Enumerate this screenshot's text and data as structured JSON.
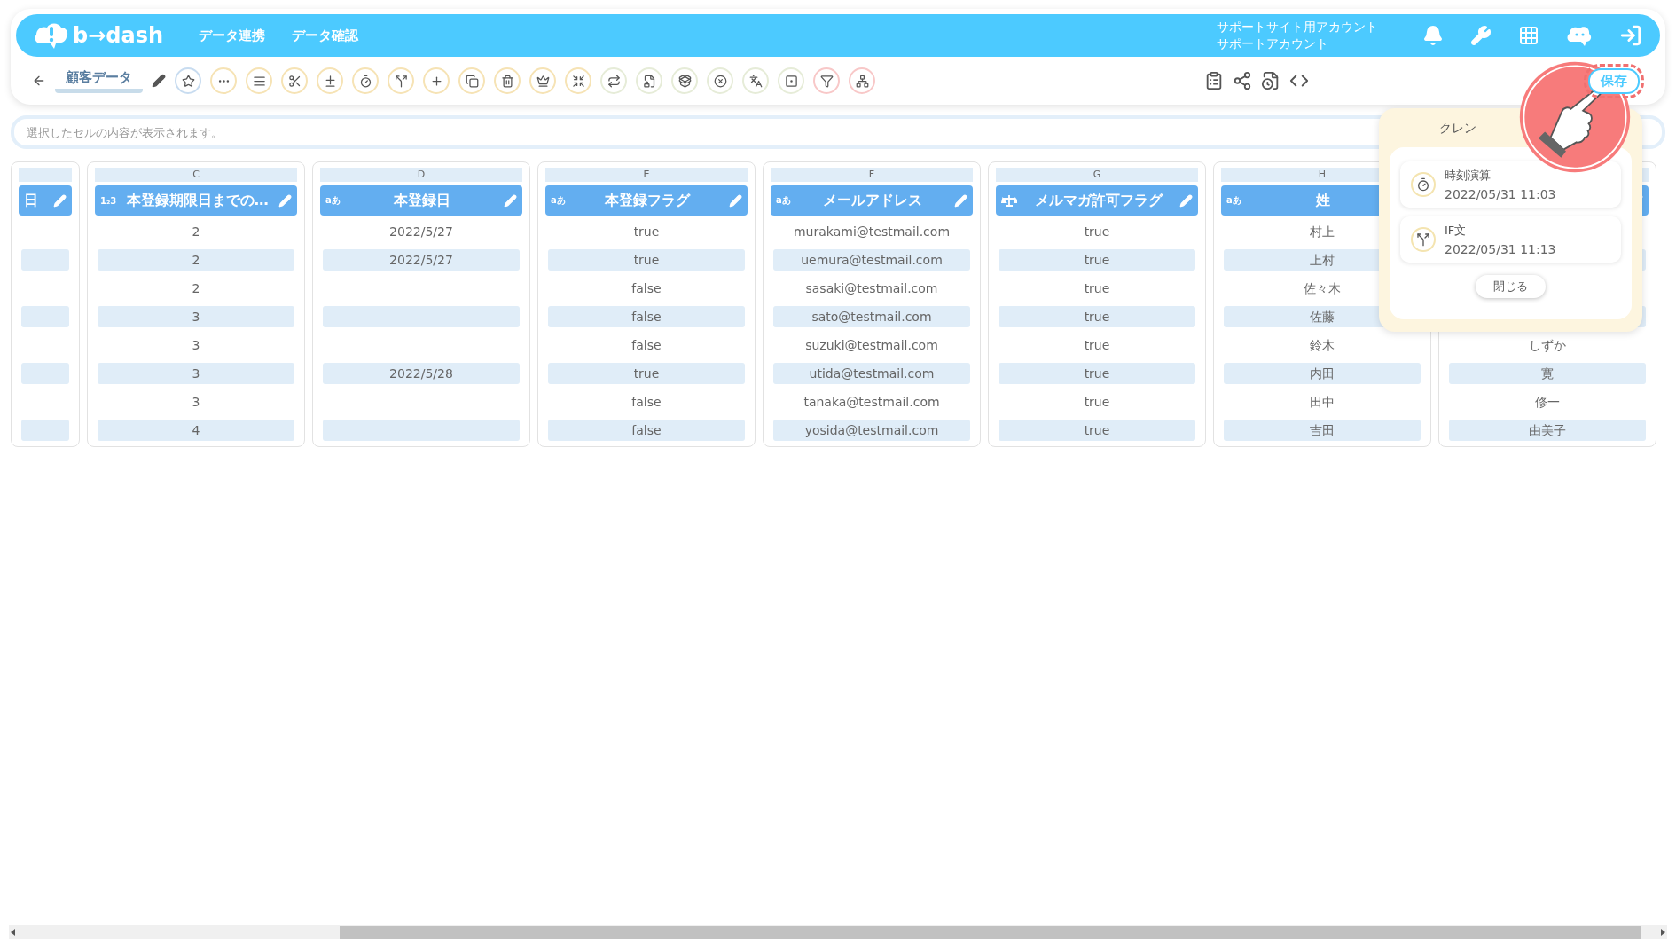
{
  "header": {
    "logo": "b→dash",
    "nav": [
      {
        "label": "データ連携"
      },
      {
        "label": "データ確認"
      }
    ],
    "account": [
      "サポートサイト用アカウント",
      "サポートアカウント"
    ]
  },
  "toolbar": {
    "title": "顧客データ",
    "save": "保存"
  },
  "formula_bar": {
    "placeholder": "選択したセルの内容が表示されます。"
  },
  "columns": [
    {
      "title": "日"
    },
    {
      "letter": "C",
      "kind": "number",
      "type_label": "1₂3",
      "title": "本登録期限日までの…",
      "cells": [
        "2",
        "2",
        "2",
        "3",
        "3",
        "3",
        "3",
        "4"
      ]
    },
    {
      "letter": "D",
      "kind": "text",
      "type_label": "aあ",
      "title": "本登録日",
      "cells": [
        "2022/5/27",
        "2022/5/27",
        null,
        null,
        null,
        "2022/5/28",
        null,
        null
      ]
    },
    {
      "letter": "E",
      "kind": "text",
      "type_label": "aあ",
      "title": "本登録フラグ",
      "cells": [
        "true",
        "true",
        "false",
        "false",
        "false",
        "true",
        "false",
        "false"
      ]
    },
    {
      "letter": "F",
      "kind": "text",
      "type_label": "aあ",
      "title": "メールアドレス",
      "cells": [
        "murakami@testmail.com",
        "uemura@testmail.com",
        "sasaki@testmail.com",
        "sato@testmail.com",
        "suzuki@testmail.com",
        "utida@testmail.com",
        "tanaka@testmail.com",
        "yosida@testmail.com"
      ]
    },
    {
      "letter": "G",
      "kind": "flag",
      "title": "メルマガ許可フラグ",
      "cells": [
        "true",
        "true",
        "true",
        "true",
        "true",
        "true",
        "true",
        "true"
      ]
    },
    {
      "letter": "H",
      "kind": "text",
      "type_label": "aあ",
      "title": "姓",
      "cells": [
        "村上",
        "上村",
        "佐々木",
        "佐藤",
        "鈴木",
        "内田",
        "田中",
        "吉田"
      ]
    },
    {
      "cells": [
        null,
        null,
        null,
        null,
        "しずか",
        "寛",
        "修一",
        "由美子"
      ]
    }
  ],
  "popup": {
    "title": "クレン",
    "items": [
      {
        "kind": "timer",
        "name": "時刻演算",
        "time": "2022/05/31 11:03"
      },
      {
        "kind": "branch",
        "name": "IF文",
        "time": "2022/05/31 11:13"
      }
    ],
    "close": "閉じる"
  }
}
